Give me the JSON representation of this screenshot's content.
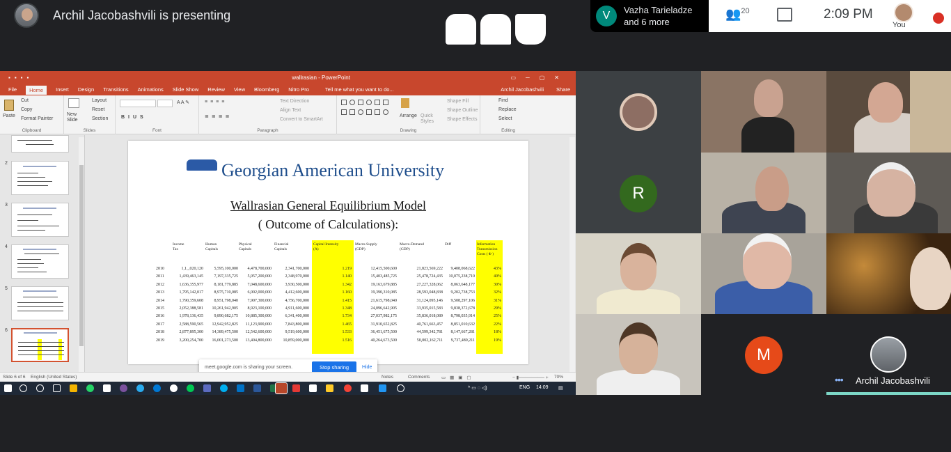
{
  "meet": {
    "presenting": "Archil Jacobashvili is presenting",
    "notice_initial": "V",
    "notice_name": "Vazha Tarieladze",
    "notice_more": "and 6 more",
    "participants_count": "20",
    "clock": "2:09 PM",
    "you_label": "You",
    "share_message": "meet.google.com is sharing your screen.",
    "stop_sharing": "Stop sharing",
    "hide": "Hide",
    "pinned_name": "Archil Jacobashvili",
    "tile_letters": {
      "r": "R",
      "m": "M"
    },
    "colors": {
      "r_avatar": "#33691e",
      "m_avatar": "#e64a19",
      "notice_avatar": "#00897b",
      "accent": "#1a73e8"
    }
  },
  "ppt": {
    "window_title": "wallrasian - PowerPoint",
    "tabs": [
      "File",
      "Home",
      "Insert",
      "Design",
      "Transitions",
      "Animations",
      "Slide Show",
      "Review",
      "View",
      "Bloomberg",
      "Nitro Pro"
    ],
    "tell_me": "Tell me what you want to do...",
    "user": "Archil Jacobashvili",
    "share": "Share",
    "ribbon": {
      "paste": "Paste",
      "cut": "Cut",
      "copy": "Copy",
      "format_painter": "Format Painter",
      "clipboard": "Clipboard",
      "new_slide": "New Slide",
      "layout": "Layout",
      "reset": "Reset",
      "section": "Section",
      "slides": "Slides",
      "font": "Font",
      "text_direction": "Text Direction",
      "align_text": "Align Text",
      "convert_smartart": "Convert to SmartArt",
      "paragraph": "Paragraph",
      "arrange": "Arrange",
      "quick_styles": "Quick Styles",
      "shape_fill": "Shape Fill",
      "shape_outline": "Shape Outline",
      "shape_effects": "Shape Effects",
      "drawing": "Drawing",
      "find": "Find",
      "replace": "Replace",
      "select": "Select",
      "editing": "Editing"
    },
    "thumb_numbers": [
      "2",
      "3",
      "4",
      "5",
      "6"
    ],
    "status_slide": "Slide 6 of 6",
    "status_lang": "English (United States)",
    "status_notes": "Notes",
    "status_comments": "Comments",
    "zoom": "70%",
    "taskbar_lang": "ENG",
    "taskbar_time": "14:09"
  },
  "slide": {
    "university": "Georgian American University",
    "title_line1": "Wallrasian General Equilibrium Model",
    "title_line2": "( Outcome of Calculations):",
    "headers": [
      "Income\nTax",
      "Human\nCapitals",
      "Physical\nCapitals",
      "Financial\nCapitals",
      "Capital Intensity\n(A)",
      "Macro-Supply\n(GDP)",
      "Macro-Demand\n(GDP)",
      "Diff",
      "Information\nTransmission\nCosts  ( Φ )"
    ],
    "rows": [
      [
        "2010",
        "1,1_,020,120",
        "5,595,100,000",
        "4,478,700,000",
        "2,341,700,000",
        "1.219",
        "12,415,500,600",
        "21,823,569,222",
        "9,408,068,622",
        "43%"
      ],
      [
        "2011",
        "1,439,463,145",
        "7,197,335,725",
        "5,057,200,000",
        "2,348,970,000",
        "1.140",
        "15,403,485,725",
        "25,478,724,435",
        "10,075,238,710",
        "40%"
      ],
      [
        "2012",
        "1,636,355,977",
        "8,181,779,885",
        "7,048,600,000",
        "3,930,500,000",
        "1.342",
        "19,163,679,885",
        "27,227,328,062",
        "8,063,648,177",
        "30%"
      ],
      [
        "2013",
        "1,795,142,017",
        "8,975,710,085",
        "6,002,000,000",
        "4,412,600,000",
        "1.160",
        "19,390,310,085",
        "28,593,048,838",
        "9,202,738,753",
        "32%"
      ],
      [
        "2014",
        "1,790,359,608",
        "8,951,798,040",
        "7,907,300,000",
        "4,756,700,000",
        "1.415",
        "21,615,798,040",
        "31,124,095,146",
        "9,508,297,106",
        "31%"
      ],
      [
        "2015",
        "2,052,388,581",
        "10,261,942,905",
        "8,923,100,000",
        "4,911,600,000",
        "1.348",
        "24,096,642,905",
        "33,935,015,583",
        "9,838,372,678",
        "29%"
      ],
      [
        "2016",
        "1,978,136,435",
        "9,890,682,175",
        "10,885,300,000",
        "6,341,400,000",
        "1.734",
        "27,037,982,175",
        "35,836,018,089",
        "8,798,035,914",
        "25%"
      ],
      [
        "2017",
        "2,588,590,565",
        "12,942,952,825",
        "11,123,900,000",
        "7,843,800,000",
        "1.465",
        "31,910,652,825",
        "40,761,663,457",
        "8,851,010,632",
        "22%"
      ],
      [
        "2018",
        "2,877,895,300",
        "14,389,475,500",
        "12,542,600,000",
        "9,519,600,000",
        "1.533",
        "36,451,675,500",
        "44,599,342,781",
        "8,147,667,281",
        "18%"
      ],
      [
        "2019",
        "3,200,254,700",
        "16,001,273,500",
        "13,404,800,000",
        "10,859,000,000",
        "1.516",
        "40,264,673,500",
        "50,002,162,711",
        "9,737,489,211",
        "19%"
      ]
    ]
  }
}
